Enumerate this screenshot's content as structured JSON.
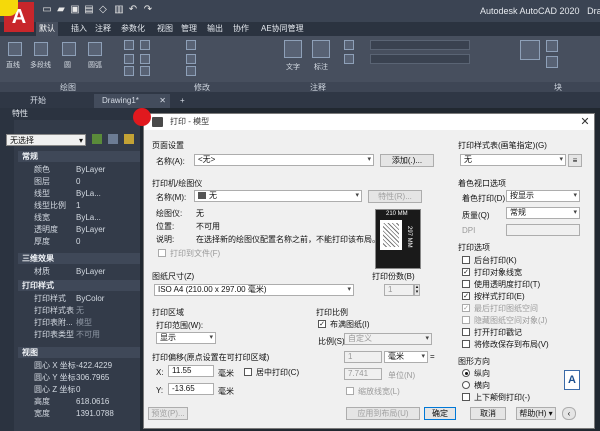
{
  "app": {
    "logo": "A",
    "title": "Autodesk AutoCAD 2020",
    "title_extra": "Drawi"
  },
  "ribbon": {
    "tabs": [
      "默认",
      "插入",
      "注释",
      "参数化",
      "视图",
      "管理",
      "输出",
      "协作",
      "AE协同管理"
    ],
    "active_tab": "默认",
    "left_labels": [
      "直线",
      "多段线",
      "圆",
      "圆弧"
    ],
    "annot_labels": [
      "文字",
      "标注"
    ],
    "panel_labels": {
      "draw": "绘图",
      "modify": "修改",
      "annotation": "注释",
      "block": "块"
    }
  },
  "doc_tabs": {
    "start": "开始",
    "drawing": "Drawing1*"
  },
  "properties": {
    "header": "特性",
    "selection": "无选择",
    "sections": {
      "general": "常规",
      "three_d": "三维效果",
      "plot": "打印样式",
      "view": "视图"
    },
    "general_rows": [
      {
        "label": "颜色",
        "value": "ByLayer"
      },
      {
        "label": "图层",
        "value": "0"
      },
      {
        "label": "线型",
        "value": "ByLa..."
      },
      {
        "label": "线型比例",
        "value": "1"
      },
      {
        "label": "线宽",
        "value": "ByLa..."
      },
      {
        "label": "透明度",
        "value": "ByLayer"
      },
      {
        "label": "厚度",
        "value": "0"
      }
    ],
    "three_d_rows": [
      {
        "label": "材质",
        "value": "ByLayer"
      }
    ],
    "plot_rows": [
      {
        "label": "打印样式",
        "value": "ByColor"
      },
      {
        "label": "打印样式表",
        "value": "无"
      },
      {
        "label": "打印表附...",
        "value": "模型"
      },
      {
        "label": "打印表类型",
        "value": "不可用"
      }
    ],
    "view_rows": [
      {
        "label": "圆心 X 坐标",
        "value": "-422.4229"
      },
      {
        "label": "圆心 Y 坐标",
        "value": "306.7965"
      },
      {
        "label": "圆心 Z 坐标",
        "value": "0"
      },
      {
        "label": "高度",
        "value": "618.0616"
      },
      {
        "label": "宽度",
        "value": "1391.0788"
      }
    ]
  },
  "dialog": {
    "title": "打印 - 模型",
    "page_setup": {
      "label": "页面设置",
      "name_label": "名称(A):",
      "name_value": "<无>",
      "add_btn": "添加(.)..."
    },
    "printer": {
      "label": "打印机/绘图仪",
      "name_label": "名称(M):",
      "name_value": "无",
      "props_btn": "特性(R)...",
      "plotter_label": "绘图仪:",
      "plotter_value": "无",
      "location_label": "位置:",
      "location_value": "不可用",
      "desc_label": "说明:",
      "desc_value": "在选择新的绘图仪配置名称之前，不能打印该布局。",
      "to_file": "打印到文件(F)",
      "dim_w": "210 MM",
      "dim_h": "297 MM"
    },
    "paper_size": {
      "label": "图纸尺寸(Z)",
      "value": "ISO A4 (210.00 x 297.00 毫米)"
    },
    "copies": {
      "label": "打印份数(B)",
      "value": "1"
    },
    "plot_area": {
      "label": "打印区域",
      "range_label": "打印范围(W):",
      "range_value": "显示"
    },
    "plot_scale": {
      "label": "打印比例",
      "fit": "布满图纸(I)",
      "scale_label": "比例(S):",
      "scale_value": "自定义",
      "val1": "1",
      "unit1": "毫米",
      "eq": "=",
      "val2": "7.741",
      "unit2": "单位(N)",
      "lineweights": "缩放线宽(L)"
    },
    "plot_offset": {
      "label": "打印偏移(原点设置在可打印区域)",
      "x_label": "X:",
      "x_value": "11.55",
      "x_unit": "毫米",
      "y_label": "Y:",
      "y_value": "-13.65",
      "y_unit": "毫米",
      "center": "居中打印(C)"
    },
    "style_table": {
      "label": "打印样式表(画笔指定)(G)",
      "value": "无"
    },
    "shaded": {
      "label": "着色视口选项",
      "shade_label": "着色打印(D)",
      "shade_value": "按显示",
      "quality_label": "质量(Q)",
      "quality_value": "常规",
      "dpi_label": "DPI"
    },
    "options": {
      "label": "打印选项",
      "items": [
        {
          "text": "后台打印(K)",
          "checked": false,
          "enabled": true
        },
        {
          "text": "打印对象线宽",
          "checked": true,
          "enabled": true
        },
        {
          "text": "使用透明度打印(T)",
          "checked": false,
          "enabled": true
        },
        {
          "text": "按样式打印(E)",
          "checked": true,
          "enabled": true
        },
        {
          "text": "最后打印图纸空间",
          "checked": true,
          "enabled": false
        },
        {
          "text": "隐藏图纸空间对象(J)",
          "checked": false,
          "enabled": false
        },
        {
          "text": "打开打印戳记",
          "checked": false,
          "enabled": true
        },
        {
          "text": "将修改保存到布局(V)",
          "checked": false,
          "enabled": true
        }
      ]
    },
    "orientation": {
      "label": "图形方向",
      "portrait": "纵向",
      "landscape": "横向",
      "upside": "上下颠倒打印(-)"
    },
    "buttons": {
      "preview": "预览(P)...",
      "apply": "应用到布局(U)",
      "ok": "确定",
      "cancel": "取消",
      "help": "帮助(H)"
    }
  }
}
